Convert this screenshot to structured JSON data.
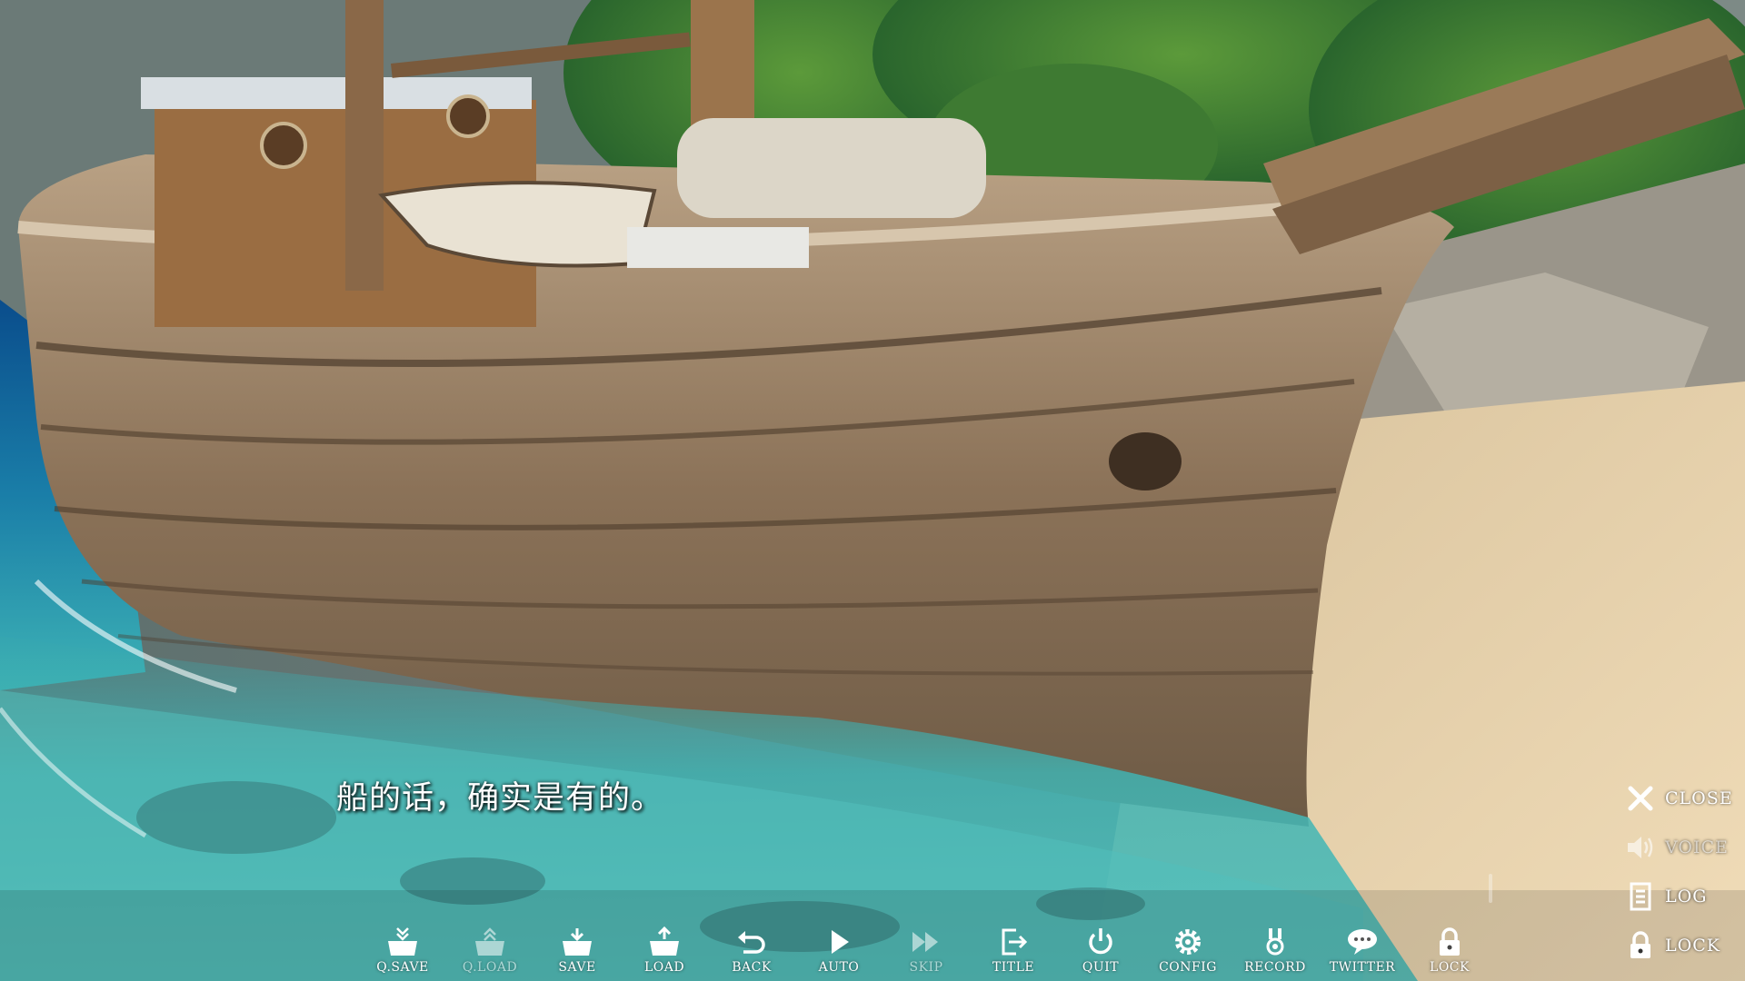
{
  "dialogue": {
    "text": "船的话，确实是有的。"
  },
  "side_menu": [
    {
      "key": "close",
      "label": "CLOSE",
      "icon": "close-icon"
    },
    {
      "key": "voice",
      "label": "VOICE",
      "icon": "speaker-icon"
    },
    {
      "key": "log",
      "label": "LOG",
      "icon": "log-icon"
    },
    {
      "key": "lock",
      "label": "LOCK",
      "icon": "lock-icon"
    }
  ],
  "toolbar": [
    {
      "key": "qsave",
      "label": "Q.SAVE",
      "icon": "quick-save-icon"
    },
    {
      "key": "qload",
      "label": "Q.LOAD",
      "icon": "quick-load-icon"
    },
    {
      "key": "save",
      "label": "SAVE",
      "icon": "save-icon"
    },
    {
      "key": "load",
      "label": "LOAD",
      "icon": "load-icon"
    },
    {
      "key": "back",
      "label": "BACK",
      "icon": "back-arrow-icon"
    },
    {
      "key": "auto",
      "label": "AUTO",
      "icon": "play-icon"
    },
    {
      "key": "skip",
      "label": "SKIP",
      "icon": "fast-forward-icon"
    },
    {
      "key": "title",
      "label": "TITLE",
      "icon": "exit-door-icon"
    },
    {
      "key": "quit",
      "label": "QUIT",
      "icon": "power-icon"
    },
    {
      "key": "config",
      "label": "CONFIG",
      "icon": "gear-icon"
    },
    {
      "key": "record",
      "label": "RECORD",
      "icon": "medal-icon"
    },
    {
      "key": "twitter",
      "label": "TWITTER",
      "icon": "speech-bubble-icon"
    },
    {
      "key": "lock2",
      "label": "LOCK",
      "icon": "lock-icon"
    }
  ],
  "colors": {
    "ui_text": "#ffffff",
    "sea": "#1c8fb0",
    "sand": "#e6cfa4",
    "hull": "#8a6f52"
  }
}
